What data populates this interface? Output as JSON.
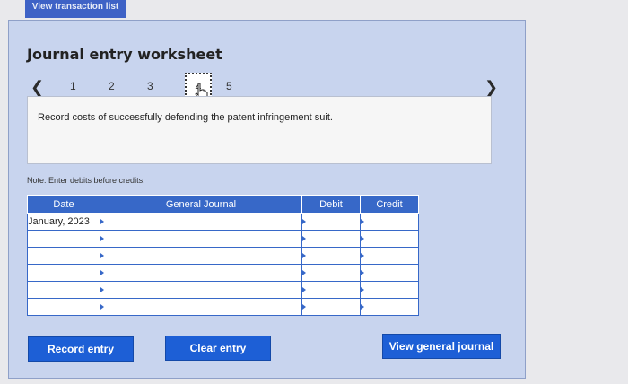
{
  "top_tab": {
    "label": "View transaction list"
  },
  "worksheet": {
    "title": "Journal entry worksheet",
    "steps": [
      "1",
      "2",
      "3",
      "4",
      "5"
    ],
    "description": "Record costs of successfully defending the patent infringement suit.",
    "note": "Note: Enter debits before credits."
  },
  "table": {
    "headers": {
      "date": "Date",
      "general_journal": "General Journal",
      "debit": "Debit",
      "credit": "Credit"
    },
    "first_date": "January, 2023"
  },
  "buttons": {
    "record": "Record entry",
    "clear": "Clear entry",
    "view_journal": "View general journal"
  },
  "colors": {
    "accent": "#1d5fd6",
    "header": "#3768c8",
    "panel": "#c8d4ee"
  }
}
